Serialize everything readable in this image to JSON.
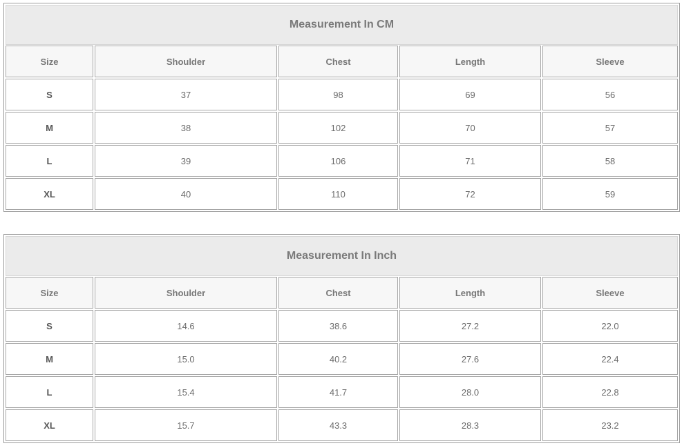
{
  "tables": [
    {
      "title": "Measurement In CM",
      "headers": [
        "Size",
        "Shoulder",
        "Chest",
        "Length",
        "Sleeve"
      ],
      "rows": [
        [
          "S",
          "37",
          "98",
          "69",
          "56"
        ],
        [
          "M",
          "38",
          "102",
          "70",
          "57"
        ],
        [
          "L",
          "39",
          "106",
          "71",
          "58"
        ],
        [
          "XL",
          "40",
          "110",
          "72",
          "59"
        ]
      ]
    },
    {
      "title": "Measurement In Inch",
      "headers": [
        "Size",
        "Shoulder",
        "Chest",
        "Length",
        "Sleeve"
      ],
      "rows": [
        [
          "S",
          "14.6",
          "38.6",
          "27.2",
          "22.0"
        ],
        [
          "M",
          "15.0",
          "40.2",
          "27.6",
          "22.4"
        ],
        [
          "L",
          "15.4",
          "41.7",
          "28.0",
          "22.8"
        ],
        [
          "XL",
          "15.7",
          "43.3",
          "28.3",
          "23.2"
        ]
      ]
    }
  ],
  "colors": {
    "title_background": "#ebebeb",
    "header_background": "#f7f7f7",
    "border": "#a6a6a6",
    "text": "#6b6b6b"
  }
}
